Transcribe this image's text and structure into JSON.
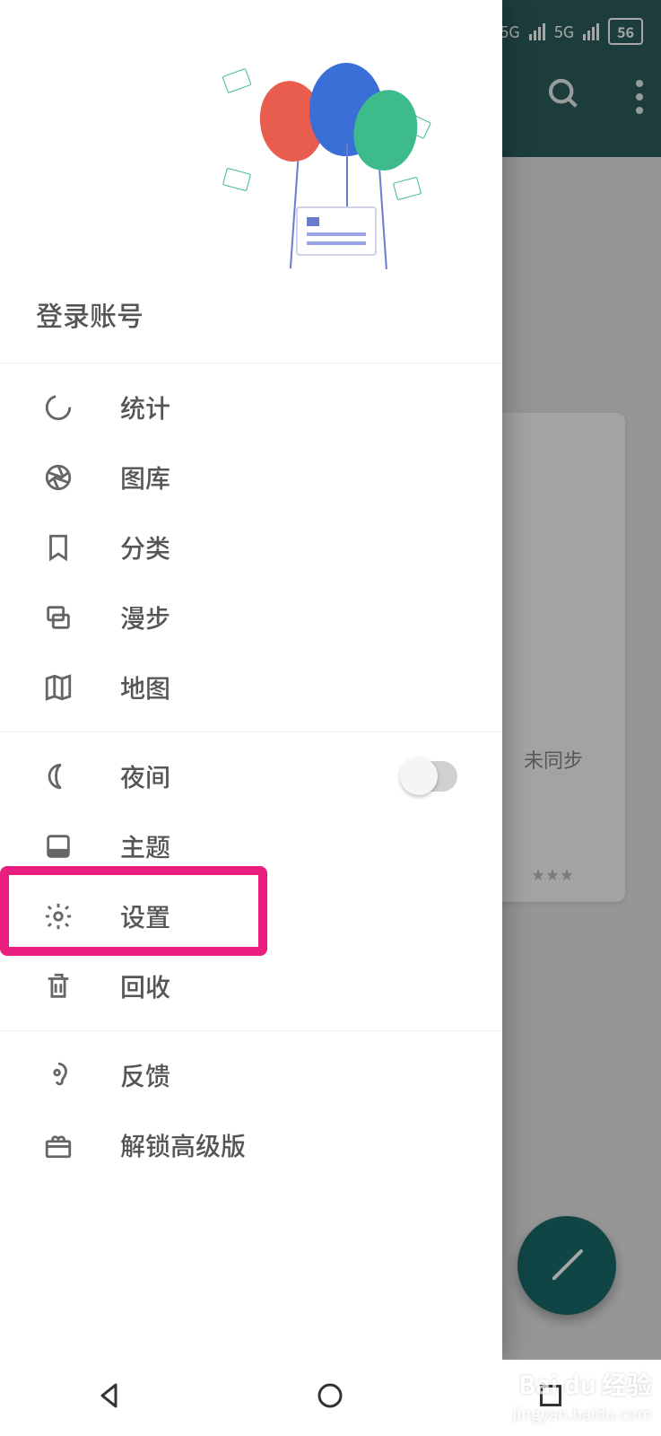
{
  "status_bar": {
    "net_label_1": "5G",
    "net_label_2": "5G",
    "battery": "56"
  },
  "background": {
    "card_sync_label": "未同步",
    "card_stars": "★★★"
  },
  "drawer": {
    "login_label": "登录账号",
    "section1": [
      {
        "icon": "circle-progress",
        "label": "统计"
      },
      {
        "icon": "aperture",
        "label": "图库"
      },
      {
        "icon": "bookmark",
        "label": "分类"
      },
      {
        "icon": "layers",
        "label": "漫步"
      },
      {
        "icon": "map",
        "label": "地图"
      }
    ],
    "section2": [
      {
        "icon": "moon",
        "label": "夜间",
        "toggle": true
      },
      {
        "icon": "theme",
        "label": "主题"
      },
      {
        "icon": "gear",
        "label": "设置"
      },
      {
        "icon": "trash",
        "label": "回收"
      }
    ],
    "section3": [
      {
        "icon": "ear",
        "label": "反馈"
      },
      {
        "icon": "gift",
        "label": "解锁高级版"
      }
    ]
  },
  "watermark": {
    "brand": "Bai du 经验",
    "url": "jingyan.baidu.com"
  }
}
